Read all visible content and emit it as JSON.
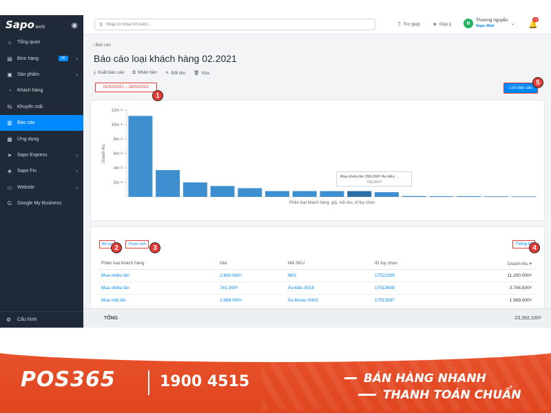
{
  "sidebar": {
    "logo": "Sapo",
    "logo_suffix": "web",
    "items": [
      {
        "label": "Tổng quan",
        "icon": "home-icon"
      },
      {
        "label": "Đơn hàng",
        "icon": "order-icon",
        "badge": "05"
      },
      {
        "label": "Sản phẩm",
        "icon": "box-icon"
      },
      {
        "label": "Khách hàng",
        "icon": "user-icon"
      },
      {
        "label": "Khuyến mãi",
        "icon": "discount-icon"
      },
      {
        "label": "Báo cáo",
        "icon": "chart-icon"
      },
      {
        "label": "Ứng dụng",
        "icon": "apps-icon"
      },
      {
        "label": "Sapo Express",
        "icon": "truck-icon"
      },
      {
        "label": "Sapo Fin",
        "icon": "finance-icon"
      },
      {
        "label": "Website",
        "icon": "website-icon"
      },
      {
        "label": "Google My Business",
        "icon": "google-icon"
      }
    ],
    "config_label": "Cấu hình"
  },
  "topbar": {
    "search_placeholder": "Nhập từ khóa tìm kiếm...",
    "help": "Trợ giúp",
    "feedback": "Góp ý",
    "user_name": "Thương nguyễn",
    "user_store": "Sapo Web",
    "avatar_letter": "N",
    "notifications": "73"
  },
  "page": {
    "back": "Báo cáo",
    "title": "Báo cáo loại khách hàng 02.2021",
    "actions": [
      "Xuất báo cáo",
      "Nhân bản",
      "Đổi tên",
      "Xóa"
    ],
    "date_range": "01/02/2021 – 28/02/2021",
    "save_label": "Lưu báo cáo"
  },
  "chart_data": {
    "type": "bar",
    "ylabel": "Doanh thu",
    "xlabel": "Phân loại khách hàng, giá, mã sku, id tùy chọn",
    "ytick_labels": [
      "12m ₫",
      "10m ₫",
      "8m ₫",
      "6m ₫",
      "4m ₫",
      "2m ₫"
    ],
    "ylim": [
      0,
      12000000
    ],
    "values": [
      11200000,
      3706500,
      1999000,
      1500000,
      1200000,
      800000,
      800000,
      798000,
      798000,
      650000,
      120000,
      100000,
      100000,
      80000,
      60000
    ],
    "highlight_index": 8,
    "tooltip_title": "Mua nhiều lần 399,000₫ Áo kiểu ...",
    "tooltip_value": "798,000₫",
    "color": "#3d8fcf",
    "highlight_color": "#2e6fa3"
  },
  "table": {
    "filter_label": "Bộ lọc",
    "attribute_label": "Thuộc tính",
    "stats_label": "Thống kê",
    "headers": [
      "Phân loại khách hàng",
      "Giá",
      "Mã SKU",
      "ID tùy chọn",
      "Doanh thu ▾"
    ],
    "rows": [
      [
        "Mua nhiều lần",
        "2.800.000₫",
        "M01",
        "17522209",
        "11.200.000₫"
      ],
      [
        "Mua nhiều lần",
        "741.300₫",
        "Áo kiểu 0018",
        "17513608",
        "3.706.500₫"
      ],
      [
        "Mua một lần",
        "1.999.000₫",
        "Áo khoác 0003",
        "17513597",
        "1.999.000₫"
      ]
    ],
    "total_label": "TỔNG",
    "total_value": "23,392,100₫"
  },
  "markers": [
    "1",
    "2",
    "3",
    "4",
    "5"
  ],
  "footer": {
    "brand": "POS365",
    "phone": "1900 4515",
    "slogan_line1": "BÁN HÀNG NHANH",
    "slogan_line2": "THANH TOÁN CHUẨN"
  }
}
